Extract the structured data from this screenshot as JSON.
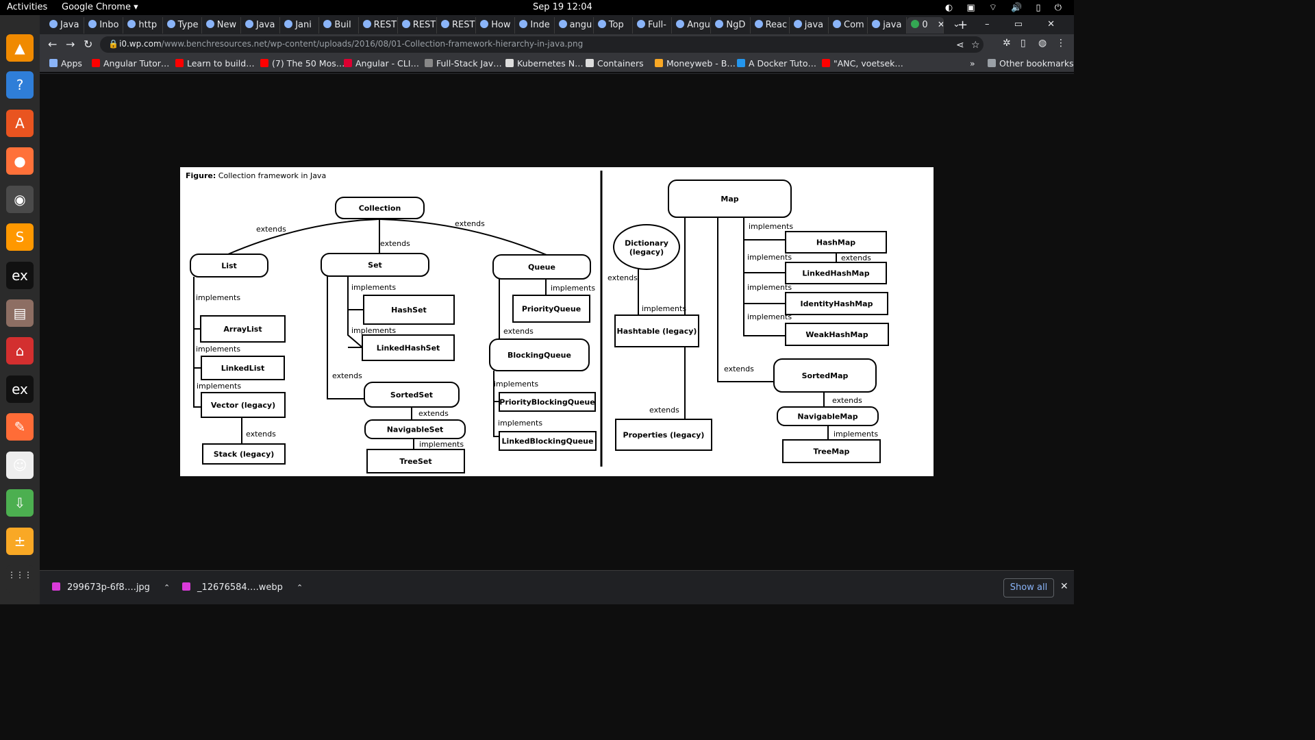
{
  "system": {
    "activities": "Activities",
    "app_name": "Google Chrome ▾",
    "clock": "Sep 19  12:04",
    "tray": "◐ ▣ ⌔ 🔊 ▯ ⏻"
  },
  "dock": {
    "items": [
      {
        "name": "vlc-icon",
        "glyph": "▲",
        "color": "#f08a00"
      },
      {
        "name": "help-icon",
        "glyph": "?",
        "color": "#2f7ed8"
      },
      {
        "name": "software-center-icon",
        "glyph": "A",
        "color": "#e95420"
      },
      {
        "name": "firefox-icon",
        "glyph": "●",
        "color": "#ff7139"
      },
      {
        "name": "chrome-icon",
        "glyph": "◉",
        "color": "#4285f4"
      },
      {
        "name": "sublime-icon",
        "glyph": "S",
        "color": "#ff9800"
      },
      {
        "name": "exness-icon",
        "glyph": "ex",
        "color": "#111111"
      },
      {
        "name": "book-icon",
        "glyph": "▤",
        "color": "#8d6e63"
      },
      {
        "name": "pdf-icon",
        "glyph": "⌂",
        "color": "#d32f2f"
      },
      {
        "name": "exness-icon-2",
        "glyph": "ex",
        "color": "#111111"
      },
      {
        "name": "postman-icon",
        "glyph": "✎",
        "color": "#ff6c37"
      },
      {
        "name": "gimp-icon",
        "glyph": "☺",
        "color": "#eeeeee"
      },
      {
        "name": "installer-icon",
        "glyph": "⇩",
        "color": "#4caf50"
      },
      {
        "name": "calculator-icon",
        "glyph": "±",
        "color": "#f9a825"
      },
      {
        "name": "show-apps-icon",
        "glyph": "⋮⋮⋮",
        "color": "#2b2b2b"
      }
    ]
  },
  "tabs": [
    {
      "label": "Java"
    },
    {
      "label": "Inbo"
    },
    {
      "label": "http"
    },
    {
      "label": "Type"
    },
    {
      "label": "New"
    },
    {
      "label": "Java"
    },
    {
      "label": "Jani"
    },
    {
      "label": "Buil"
    },
    {
      "label": "REST"
    },
    {
      "label": "REST"
    },
    {
      "label": "REST"
    },
    {
      "label": "How"
    },
    {
      "label": "Inde"
    },
    {
      "label": "angu"
    },
    {
      "label": "Top"
    },
    {
      "label": "Full-"
    },
    {
      "label": "Angu"
    },
    {
      "label": "NgD"
    },
    {
      "label": "Reac"
    },
    {
      "label": "java"
    },
    {
      "label": "Com"
    },
    {
      "label": "java"
    },
    {
      "label": "0",
      "active": true
    }
  ],
  "toolbar": {
    "new_tab": "+",
    "window_controls": "⌄ – ▭ ✕",
    "back": "←",
    "forward": "→",
    "reload": "↻",
    "url_host": "i0.wp.com",
    "url_path": "/www.benchresources.net/wp-content/uploads/2016/08/01-Collection-framework-hierarchy-in-java.png",
    "share": "⋖",
    "star": "☆",
    "extensions": "✲",
    "sidebar": "▯",
    "profile": "◍",
    "menu": "⋮"
  },
  "bookmarks": [
    {
      "label": "Apps",
      "color": "#8ab4f8"
    },
    {
      "label": "Angular Tutor…",
      "color": "#ff0000"
    },
    {
      "label": "Learn to build…",
      "color": "#ff0000"
    },
    {
      "label": "(7) The 50 Mos…",
      "color": "#ff0000"
    },
    {
      "label": "Angular - CLI…",
      "color": "#dd0031"
    },
    {
      "label": "Full-Stack Jav…",
      "color": "#888888"
    },
    {
      "label": "Kubernetes N…",
      "color": "#dddddd"
    },
    {
      "label": "Containers",
      "color": "#dddddd"
    },
    {
      "label": "Moneyweb - B…",
      "color": "#f9a825"
    },
    {
      "label": "A Docker Tuto…",
      "color": "#2496ed"
    },
    {
      "label": "\"ANC, voetsek…",
      "color": "#ff0000"
    }
  ],
  "bookmarks_overflow": "»",
  "other_bookmarks": "Other bookmarks",
  "figure": {
    "caption_bold": "Figure:",
    "caption_text": "Collection framework in Java",
    "nodes": [
      {
        "id": "collection",
        "label": "Collection"
      },
      {
        "id": "list",
        "label": "List"
      },
      {
        "id": "set",
        "label": "Set"
      },
      {
        "id": "queue",
        "label": "Queue"
      },
      {
        "id": "arraylist",
        "label": "ArrayList"
      },
      {
        "id": "linkedlist",
        "label": "LinkedList"
      },
      {
        "id": "vector",
        "label": "Vector (legacy)"
      },
      {
        "id": "stack",
        "label": "Stack (legacy)"
      },
      {
        "id": "hashset",
        "label": "HashSet"
      },
      {
        "id": "linkedhashset",
        "label": "LinkedHashSet"
      },
      {
        "id": "sortedset",
        "label": "SortedSet"
      },
      {
        "id": "navigableset",
        "label": "NavigableSet"
      },
      {
        "id": "treeset",
        "label": "TreeSet"
      },
      {
        "id": "priorityqueue",
        "label": "PriorityQueue"
      },
      {
        "id": "blockingqueue",
        "label": "BlockingQueue"
      },
      {
        "id": "priorityblockingqueue",
        "label": "PriorityBlockingQueue"
      },
      {
        "id": "linkedblockingqueue",
        "label": "LinkedBlockingQueue"
      },
      {
        "id": "map",
        "label": "Map"
      },
      {
        "id": "dictionary",
        "label": "Dictionary (legacy)"
      },
      {
        "id": "hashtable",
        "label": "Hashtable (legacy)"
      },
      {
        "id": "properties",
        "label": "Properties (legacy)"
      },
      {
        "id": "hashmap",
        "label": "HashMap"
      },
      {
        "id": "linkedhashmap",
        "label": "LinkedHashMap"
      },
      {
        "id": "identityhashmap",
        "label": "IdentityHashMap"
      },
      {
        "id": "weakhashmap",
        "label": "WeakHashMap"
      },
      {
        "id": "sortedmap",
        "label": "SortedMap"
      },
      {
        "id": "navigablemap",
        "label": "NavigableMap"
      },
      {
        "id": "treemap",
        "label": "TreeMap"
      }
    ],
    "edge_labels": {
      "extends": "extends",
      "implements": "implements"
    }
  },
  "downloads": [
    {
      "label": "299673p-6f8….jpg"
    },
    {
      "label": "_12676584….webp"
    }
  ],
  "show_all": "Show all",
  "close": "✕"
}
